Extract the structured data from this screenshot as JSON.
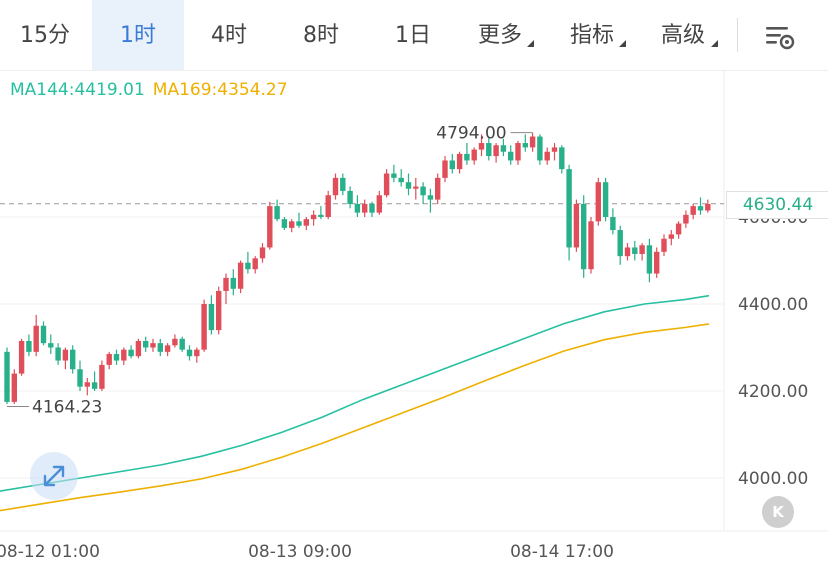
{
  "tabs": [
    {
      "label": "15分"
    },
    {
      "label": "1时",
      "active": true
    },
    {
      "label": "4时"
    },
    {
      "label": "8时"
    },
    {
      "label": "1日"
    },
    {
      "label": "更多",
      "dropdown": true
    },
    {
      "label": "指标",
      "dropdown": true
    },
    {
      "label": "高级",
      "dropdown": true
    }
  ],
  "settings_icon": "chart-settings-icon",
  "indicators": {
    "ma144": "MA144:4419.01",
    "ma169": "MA169:4354.27"
  },
  "colors": {
    "up": "#e04e5a",
    "down": "#27b089",
    "ma144": "#27c0a0",
    "ma169": "#eeb000",
    "active_tab": "#3a7bd5"
  },
  "last_price": "4630.44",
  "controls": {
    "collapse_icon": "collapse-left-icon",
    "collapse_glyph": "K",
    "expand_icon": "expand-arrows-icon"
  },
  "chart_data": {
    "type": "candlestick",
    "y_ticks": [
      "4600.00",
      "4400.00",
      "4200.00",
      "4000.00"
    ],
    "y_tick_values": [
      4600,
      4400,
      4200,
      4000
    ],
    "x_ticks": [
      "08-12 01:00",
      "08-13 09:00",
      "08-14 17:00"
    ],
    "high_label": "4794.00",
    "high_value": 4794.0,
    "low_label": "4164.23",
    "low_value": 4164.23,
    "last_value": 4630.44,
    "candles": [
      [
        4290,
        4300,
        4170,
        4175
      ],
      [
        4175,
        4250,
        4170,
        4240
      ],
      [
        4240,
        4320,
        4235,
        4315
      ],
      [
        4315,
        4330,
        4280,
        4290
      ],
      [
        4290,
        4375,
        4280,
        4350
      ],
      [
        4350,
        4360,
        4305,
        4310
      ],
      [
        4310,
        4330,
        4285,
        4300
      ],
      [
        4300,
        4310,
        4260,
        4270
      ],
      [
        4270,
        4300,
        4250,
        4295
      ],
      [
        4295,
        4305,
        4240,
        4250
      ],
      [
        4250,
        4270,
        4200,
        4210
      ],
      [
        4210,
        4230,
        4190,
        4220
      ],
      [
        4220,
        4245,
        4200,
        4205
      ],
      [
        4205,
        4270,
        4200,
        4260
      ],
      [
        4260,
        4290,
        4250,
        4285
      ],
      [
        4285,
        4295,
        4260,
        4270
      ],
      [
        4270,
        4300,
        4260,
        4295
      ],
      [
        4295,
        4305,
        4275,
        4280
      ],
      [
        4280,
        4320,
        4275,
        4315
      ],
      [
        4315,
        4325,
        4290,
        4300
      ],
      [
        4300,
        4320,
        4290,
        4310
      ],
      [
        4310,
        4320,
        4280,
        4290
      ],
      [
        4290,
        4310,
        4280,
        4305
      ],
      [
        4305,
        4330,
        4300,
        4320
      ],
      [
        4320,
        4325,
        4290,
        4295
      ],
      [
        4295,
        4305,
        4270,
        4280
      ],
      [
        4280,
        4300,
        4265,
        4295
      ],
      [
        4295,
        4410,
        4290,
        4400
      ],
      [
        4400,
        4420,
        4330,
        4340
      ],
      [
        4340,
        4440,
        4330,
        4430
      ],
      [
        4430,
        4470,
        4400,
        4460
      ],
      [
        4460,
        4480,
        4420,
        4435
      ],
      [
        4435,
        4500,
        4425,
        4495
      ],
      [
        4495,
        4520,
        4470,
        4480
      ],
      [
        4480,
        4510,
        4470,
        4505
      ],
      [
        4505,
        4540,
        4495,
        4530
      ],
      [
        4530,
        4635,
        4525,
        4625
      ],
      [
        4625,
        4640,
        4590,
        4595
      ],
      [
        4595,
        4600,
        4570,
        4575
      ],
      [
        4575,
        4595,
        4565,
        4590
      ],
      [
        4590,
        4610,
        4575,
        4580
      ],
      [
        4580,
        4600,
        4570,
        4595
      ],
      [
        4595,
        4615,
        4580,
        4605
      ],
      [
        4605,
        4625,
        4595,
        4600
      ],
      [
        4600,
        4660,
        4595,
        4650
      ],
      [
        4650,
        4700,
        4640,
        4690
      ],
      [
        4690,
        4700,
        4650,
        4660
      ],
      [
        4660,
        4670,
        4620,
        4630
      ],
      [
        4630,
        4650,
        4600,
        4610
      ],
      [
        4610,
        4640,
        4600,
        4630
      ],
      [
        4630,
        4635,
        4600,
        4610
      ],
      [
        4610,
        4660,
        4605,
        4650
      ],
      [
        4650,
        4710,
        4645,
        4700
      ],
      [
        4700,
        4720,
        4680,
        4690
      ],
      [
        4690,
        4710,
        4670,
        4680
      ],
      [
        4680,
        4700,
        4650,
        4665
      ],
      [
        4665,
        4690,
        4640,
        4670
      ],
      [
        4670,
        4680,
        4630,
        4650
      ],
      [
        4650,
        4665,
        4610,
        4640
      ],
      [
        4640,
        4700,
        4630,
        4690
      ],
      [
        4690,
        4740,
        4680,
        4730
      ],
      [
        4730,
        4745,
        4700,
        4710
      ],
      [
        4710,
        4750,
        4700,
        4745
      ],
      [
        4745,
        4770,
        4720,
        4730
      ],
      [
        4730,
        4760,
        4720,
        4755
      ],
      [
        4755,
        4790,
        4740,
        4770
      ],
      [
        4770,
        4785,
        4730,
        4740
      ],
      [
        4740,
        4770,
        4725,
        4765
      ],
      [
        4765,
        4780,
        4740,
        4750
      ],
      [
        4750,
        4765,
        4720,
        4730
      ],
      [
        4730,
        4775,
        4720,
        4770
      ],
      [
        4770,
        4790,
        4750,
        4760
      ],
      [
        4760,
        4794,
        4750,
        4785
      ],
      [
        4785,
        4790,
        4720,
        4730
      ],
      [
        4730,
        4760,
        4720,
        4750
      ],
      [
        4750,
        4770,
        4730,
        4760
      ],
      [
        4760,
        4765,
        4700,
        4710
      ],
      [
        4710,
        4720,
        4500,
        4530
      ],
      [
        4530,
        4640,
        4520,
        4630
      ],
      [
        4630,
        4650,
        4460,
        4480
      ],
      [
        4480,
        4600,
        4470,
        4590
      ],
      [
        4590,
        4690,
        4580,
        4680
      ],
      [
        4680,
        4690,
        4590,
        4600
      ],
      [
        4600,
        4620,
        4560,
        4570
      ],
      [
        4570,
        4580,
        4490,
        4510
      ],
      [
        4510,
        4540,
        4500,
        4530
      ],
      [
        4530,
        4545,
        4500,
        4515
      ],
      [
        4515,
        4540,
        4500,
        4535
      ],
      [
        4535,
        4550,
        4450,
        4470
      ],
      [
        4470,
        4530,
        4460,
        4520
      ],
      [
        4520,
        4560,
        4510,
        4550
      ],
      [
        4550,
        4570,
        4535,
        4560
      ],
      [
        4560,
        4590,
        4550,
        4585
      ],
      [
        4585,
        4615,
        4575,
        4605
      ],
      [
        4605,
        4630,
        4595,
        4625
      ],
      [
        4625,
        4645,
        4605,
        4615
      ],
      [
        4615,
        4640,
        4610,
        4630
      ]
    ],
    "ma144": [
      [
        0,
        3970
      ],
      [
        10,
        3985
      ],
      [
        20,
        4000
      ],
      [
        30,
        4015
      ],
      [
        40,
        4030
      ],
      [
        50,
        4050
      ],
      [
        60,
        4075
      ],
      [
        70,
        4105
      ],
      [
        80,
        4140
      ],
      [
        90,
        4180
      ],
      [
        100,
        4215
      ],
      [
        110,
        4250
      ],
      [
        120,
        4285
      ],
      [
        130,
        4320
      ],
      [
        140,
        4355
      ],
      [
        150,
        4382
      ],
      [
        160,
        4400
      ],
      [
        170,
        4410
      ],
      [
        176,
        4419.01
      ]
    ],
    "ma169": [
      [
        0,
        3925
      ],
      [
        10,
        3940
      ],
      [
        20,
        3955
      ],
      [
        30,
        3968
      ],
      [
        40,
        3982
      ],
      [
        50,
        3998
      ],
      [
        60,
        4020
      ],
      [
        70,
        4048
      ],
      [
        80,
        4080
      ],
      [
        90,
        4115
      ],
      [
        100,
        4150
      ],
      [
        110,
        4185
      ],
      [
        120,
        4222
      ],
      [
        130,
        4258
      ],
      [
        140,
        4292
      ],
      [
        150,
        4318
      ],
      [
        160,
        4335
      ],
      [
        170,
        4346
      ],
      [
        176,
        4354.27
      ]
    ]
  }
}
